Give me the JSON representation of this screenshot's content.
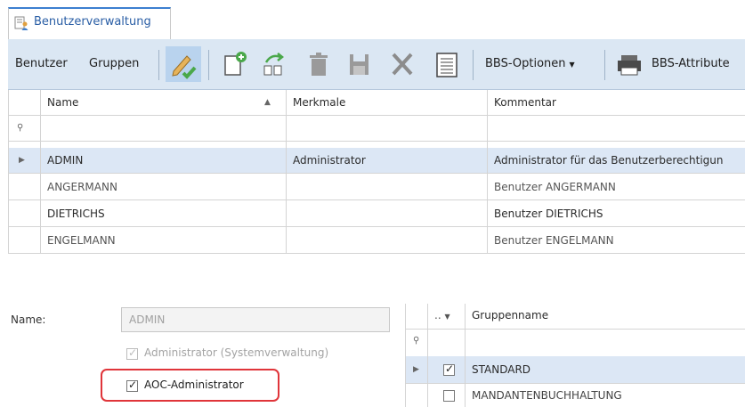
{
  "tab": {
    "title": "Benutzerverwaltung"
  },
  "ribbon": {
    "btn_benutzer": "Benutzer",
    "btn_gruppen": "Gruppen",
    "btn_bbs_optionen": "BBS-Optionen",
    "btn_bbs_attribute": "BBS-Attribute",
    "icons": [
      "edit-icon",
      "new-record-icon",
      "copy-forward-icon",
      "trash-icon",
      "save-icon",
      "close-x-icon",
      "list-document-icon",
      "printer-icon"
    ]
  },
  "users_grid": {
    "columns": [
      "Name",
      "Merkmale",
      "Kommentar"
    ],
    "sorted_column": "Name",
    "rows": [
      {
        "name": "ADMIN",
        "merkmale": "Administrator",
        "kommentar": "Administrator für das Benutzerberechtigun"
      },
      {
        "name": "ANGERMANN",
        "merkmale": "",
        "kommentar": "Benutzer ANGERMANN"
      },
      {
        "name": "DIETRICHS",
        "merkmale": "",
        "kommentar": "Benutzer DIETRICHS"
      },
      {
        "name": "ENGELMANN",
        "merkmale": "",
        "kommentar": "Benutzer ENGELMANN"
      }
    ],
    "selected_row": 0
  },
  "details": {
    "name_label": "Name:",
    "name_value": "ADMIN",
    "cb_admin_system": "Administrator (Systemverwaltung)",
    "cb_admin_system_checked": true,
    "cb_aoc_admin": "AOC-Administrator",
    "cb_aoc_admin_checked": true
  },
  "groups_grid": {
    "header_marker": "..",
    "column": "Gruppenname",
    "rows": [
      {
        "name": "STANDARD",
        "checked": true
      },
      {
        "name": "MANDANTENBUCHHALTUNG",
        "checked": false
      }
    ]
  },
  "colors": {
    "ribbon_bg": "#dbe7f3",
    "selected_row": "#dce7f5",
    "highlight_box": "#e0353a",
    "edit_check_green": "#4aa84a"
  }
}
